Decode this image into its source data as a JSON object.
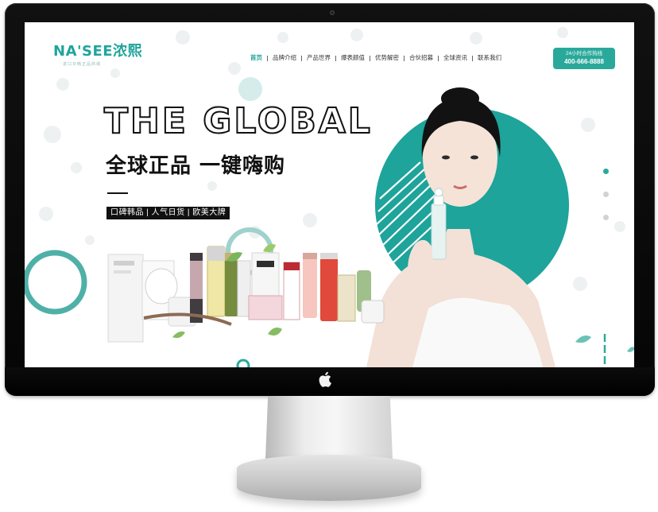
{
  "site": {
    "logo_text": "NA'SEE浓熙",
    "logo_tagline": "进口日韩正品商城"
  },
  "nav": {
    "items": [
      {
        "label": "首页",
        "active": true
      },
      {
        "label": "品牌介绍",
        "active": false
      },
      {
        "label": "产品世界",
        "active": false
      },
      {
        "label": "爆表颜值",
        "active": false
      },
      {
        "label": "优势解密",
        "active": false
      },
      {
        "label": "合伙招募",
        "active": false
      },
      {
        "label": "全球资讯",
        "active": false
      },
      {
        "label": "联系我们",
        "active": false
      }
    ]
  },
  "hotline": {
    "label": "24小时合作热线",
    "number": "400-666-8888"
  },
  "hero": {
    "title": "THE GLOBAL",
    "subtitle": "全球正品  一键嗨购",
    "tags": "口碑韩品 | 人气日货 | 欧美大牌"
  },
  "carousel": {
    "slide_count": 3,
    "active_index": 0
  },
  "colors": {
    "accent": "#2aa99b",
    "text_dark": "#111111",
    "bezel": "#0a0a0a",
    "stand": "#d8d8d8"
  },
  "icons": [
    "apple-logo-icon"
  ]
}
